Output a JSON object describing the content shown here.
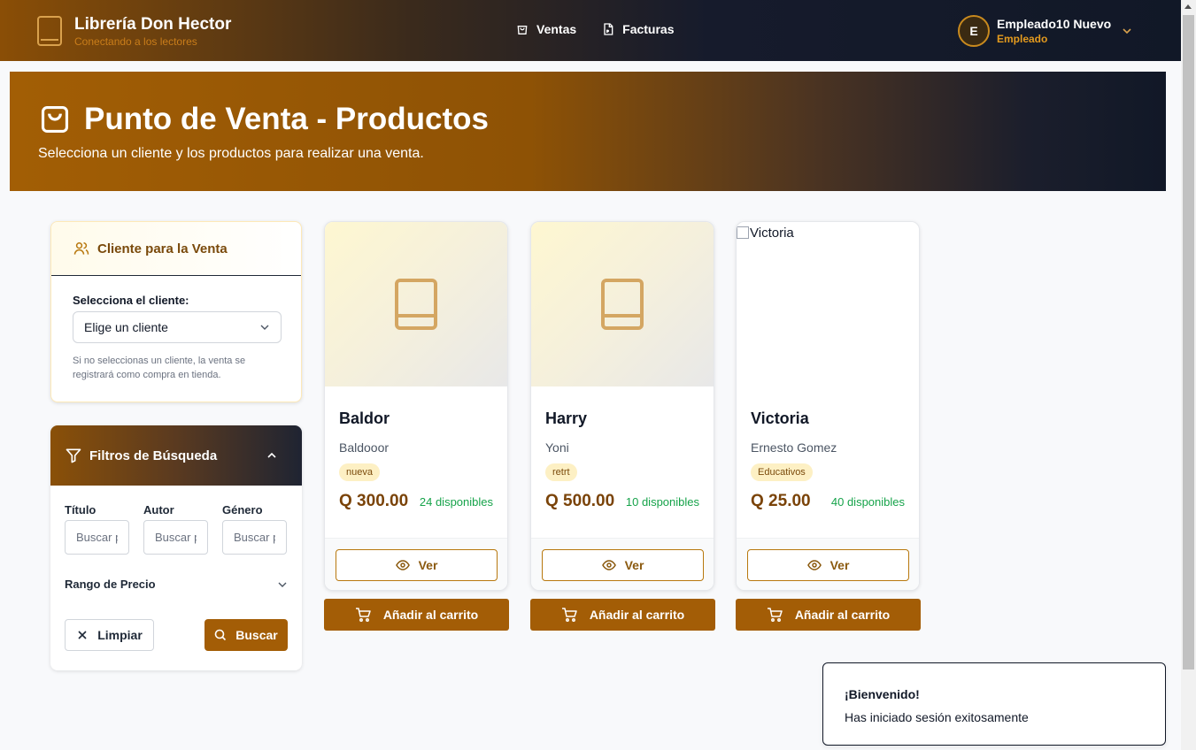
{
  "header": {
    "brand_title": "Librería Don Hector",
    "brand_subtitle": "Conectando a los lectores",
    "nav": [
      {
        "label": "Ventas",
        "icon": "shopping-bag-icon"
      },
      {
        "label": "Facturas",
        "icon": "file-invoice-icon"
      }
    ],
    "user": {
      "initial": "E",
      "name": "Empleado10 Nuevo",
      "role": "Empleado"
    }
  },
  "hero": {
    "title": "Punto de Venta - Productos",
    "subtitle": "Selecciona un cliente y los productos para realizar una venta."
  },
  "client_panel": {
    "title": "Cliente para la Venta",
    "select_label": "Selecciona el cliente:",
    "select_value": "Elige un cliente",
    "hint": "Si no seleccionas un cliente, la venta se registrará como compra en tienda."
  },
  "filters": {
    "title": "Filtros de Búsqueda",
    "fields": [
      {
        "label": "Título",
        "placeholder": "Buscar por título"
      },
      {
        "label": "Autor",
        "placeholder": "Buscar por autor"
      },
      {
        "label": "Género",
        "placeholder": "Buscar por género"
      }
    ],
    "price_range_label": "Rango de Precio",
    "clear_label": "Limpiar",
    "search_label": "Buscar"
  },
  "products": [
    {
      "title": "Baldor",
      "author": "Baldooor",
      "genre": "nueva",
      "price": "Q 300.00",
      "stock": "24 disponibles",
      "image_alt": "",
      "has_image": false
    },
    {
      "title": "Harry",
      "author": "Yoni",
      "genre": "retrt",
      "price": "Q 500.00",
      "stock": "10 disponibles",
      "image_alt": "",
      "has_image": false
    },
    {
      "title": "Victoria",
      "author": "Ernesto Gomez",
      "genre": "Educativos",
      "price": "Q 25.00",
      "stock": "40 disponibles",
      "image_alt": "Victoria",
      "has_image": true
    }
  ],
  "card_actions": {
    "view_label": "Ver",
    "cart_label": "Añadir al carrito"
  },
  "toast": {
    "title": "¡Bienvenido!",
    "message": "Has iniciado sesión exitosamente"
  },
  "colors": {
    "accent": "#a35d06",
    "brand_gold": "#d9a14d",
    "stock_green": "#16a34a",
    "nav_dark": "#111827"
  }
}
